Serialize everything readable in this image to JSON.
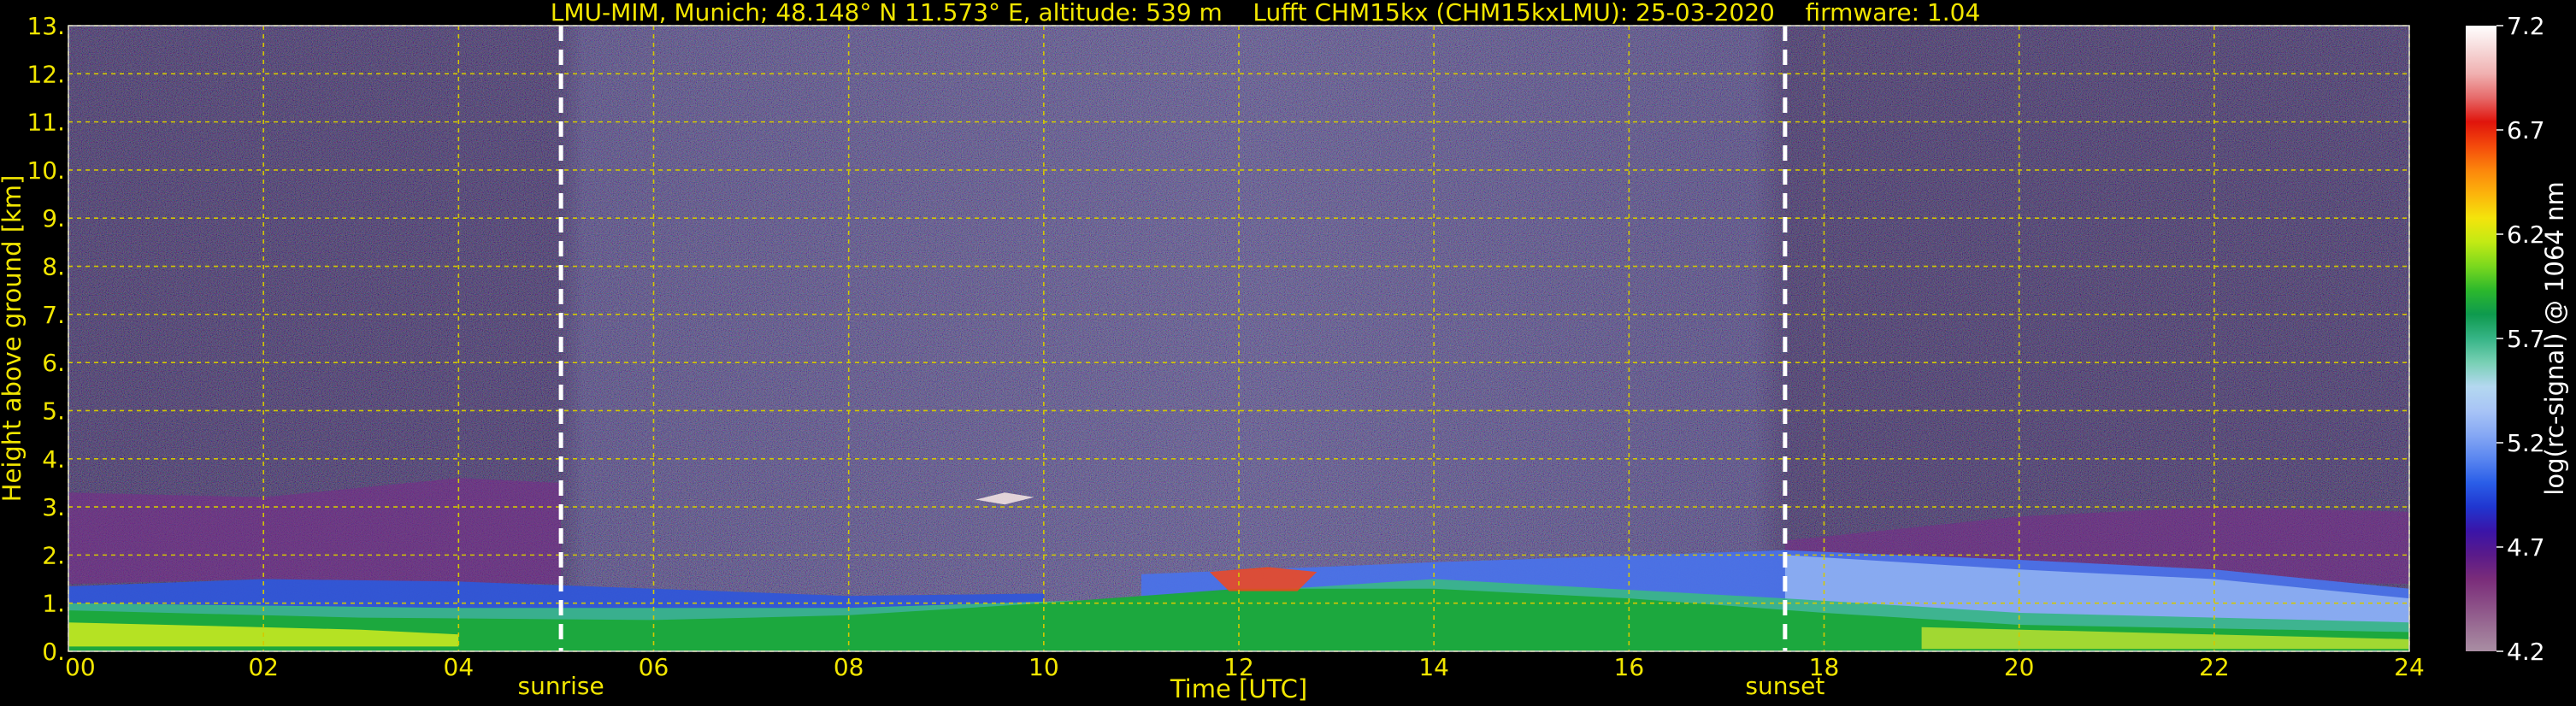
{
  "chart_data": {
    "type": "heatmap",
    "title": "LMU-MIM, Munich; 48.148° N 11.573° E, altitude: 539 m    Lufft CHM15kx (CHM15kxLMU): 25-03-2020    firmware: 1.04",
    "xlabel": "Time [UTC]",
    "ylabel": "Height above ground [km]",
    "xlim": [
      0,
      24
    ],
    "ylim": [
      0,
      13
    ],
    "x_ticks": [
      "00",
      "02",
      "04",
      "06",
      "08",
      "10",
      "12",
      "14",
      "16",
      "18",
      "20",
      "22",
      "24"
    ],
    "y_ticks": [
      "0.",
      "1.",
      "2.",
      "3.",
      "4.",
      "5.",
      "6.",
      "7.",
      "8.",
      "9.",
      "10.",
      "11.",
      "12.",
      "13."
    ],
    "grid": true,
    "annotations": [
      {
        "label": "sunrise",
        "x": 5.05
      },
      {
        "label": "sunset",
        "x": 17.6
      }
    ],
    "colorbar": {
      "label": "log(rc-signal) @ 1064 nm",
      "ticks": [
        "4.2",
        "4.7",
        "5.2",
        "5.7",
        "6.2",
        "6.7",
        "7.2"
      ],
      "range": [
        4.2,
        7.2
      ],
      "colors": [
        "#a98ea3",
        "#9a6e94",
        "#8a4c86",
        "#7a2c7a",
        "#5a1a8a",
        "#3a14a8",
        "#2036d0",
        "#2a5ee8",
        "#5a86f0",
        "#86a8f4",
        "#a8c4f6",
        "#b4d8f0",
        "#78d0b4",
        "#36b486",
        "#0e9a4e",
        "#2cb82c",
        "#7ad81e",
        "#c2ea14",
        "#f4e40c",
        "#fcb40c",
        "#fc860c",
        "#f44a0c",
        "#e0140c",
        "#e66a6a",
        "#f0b0b0",
        "#f6d8d8",
        "#ffffff"
      ]
    },
    "background_color": "#2a1c3e",
    "grid_color": "#d4c800",
    "text_color": "#f2e600"
  }
}
